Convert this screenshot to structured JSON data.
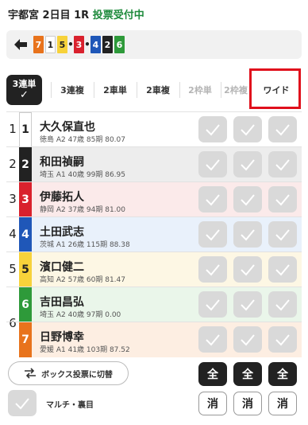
{
  "header": {
    "venue": "宇都宮",
    "day": "2日目",
    "race": "1R",
    "status": "投票受付中"
  },
  "nav": {
    "back_icon": "arrow-left-icon",
    "sequence": [
      {
        "num": "7",
        "bg": "#e8731c",
        "fg": "#ffffff",
        "sep": ""
      },
      {
        "num": "1",
        "bg": "#ffffff",
        "fg": "#222222",
        "sep": ""
      },
      {
        "num": "5",
        "bg": "#f7d23a",
        "fg": "#222222",
        "sep": "•"
      },
      {
        "num": "3",
        "bg": "#d9212d",
        "fg": "#ffffff",
        "sep": "•"
      },
      {
        "num": "4",
        "bg": "#1f57b8",
        "fg": "#ffffff",
        "sep": ""
      },
      {
        "num": "2",
        "bg": "#222222",
        "fg": "#ffffff",
        "sep": ""
      },
      {
        "num": "6",
        "bg": "#2e9a3a",
        "fg": "#ffffff",
        "sep": ""
      }
    ]
  },
  "tabs": [
    {
      "label": "3連単",
      "state": "active"
    },
    {
      "label": "3連複",
      "state": "normal"
    },
    {
      "label": "2車単",
      "state": "normal"
    },
    {
      "label": "2車複",
      "state": "normal"
    },
    {
      "label": "2枠単",
      "state": "disabled"
    },
    {
      "label": "2枠複",
      "state": "disabled"
    },
    {
      "label": "ワイド",
      "state": "normal"
    }
  ],
  "rows": [
    {
      "outer": "1",
      "frame": "1",
      "frame_bg": "#ffffff",
      "frame_fg": "#222222",
      "name": "大久保直也",
      "meta": "徳島 A2 47歳 85期 80.07",
      "bg": "#ffffff"
    },
    {
      "outer": "2",
      "frame": "2",
      "frame_bg": "#222222",
      "frame_fg": "#ffffff",
      "name": "和田禎嗣",
      "meta": "埼玉 A1 40歳 99期 86.95",
      "bg": "#ededed"
    },
    {
      "outer": "3",
      "frame": "3",
      "frame_bg": "#d9212d",
      "frame_fg": "#ffffff",
      "name": "伊藤拓人",
      "meta": "静岡 A2 37歳 94期 81.00",
      "bg": "#fbeaea"
    },
    {
      "outer": "4",
      "frame": "4",
      "frame_bg": "#1f57b8",
      "frame_fg": "#ffffff",
      "name": "土田武志",
      "meta": "茨城 A1 26歳 115期 88.38",
      "bg": "#e9f1fb"
    },
    {
      "outer": "5",
      "frame": "5",
      "frame_bg": "#f7d23a",
      "frame_fg": "#222222",
      "name": "濱口健二",
      "meta": "高知 A2 57歳 60期 81.47",
      "bg": "#fdf7e4"
    },
    {
      "outer": "6",
      "frame": "6",
      "frame_bg": "#2e9a3a",
      "frame_fg": "#ffffff",
      "name": "吉田昌弘",
      "meta": "埼玉 A2 40歳 97期 0.00",
      "bg": "#eaf6ea"
    },
    {
      "outer": "",
      "frame": "7",
      "frame_bg": "#e8731c",
      "frame_fg": "#ffffff",
      "name": "日野博幸",
      "meta": "愛媛 A1 41歳 103期 87.52",
      "bg": "#fdeee2"
    }
  ],
  "footer": {
    "box_button_label": "ボックス投票に切替",
    "box_icon": "swap-arrows-icon",
    "multi_label": "マルチ・裏目",
    "all_label": "全",
    "clear_label": "消"
  }
}
